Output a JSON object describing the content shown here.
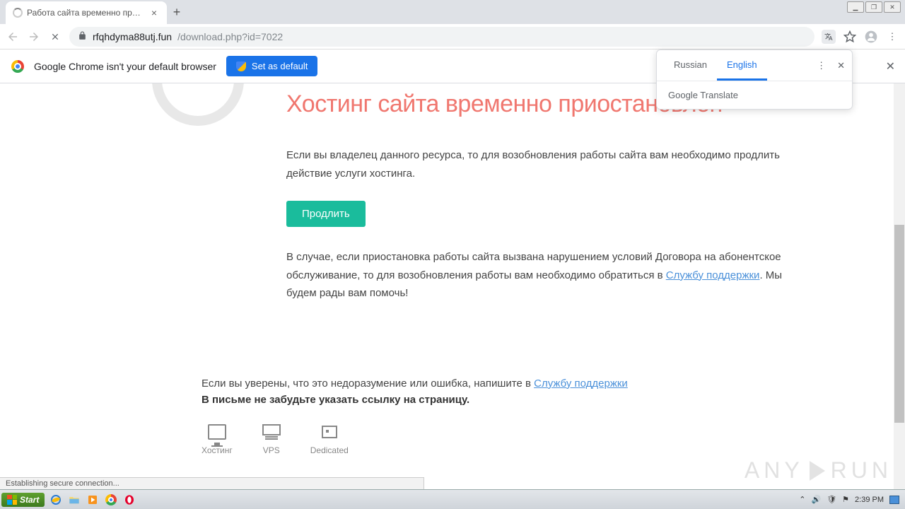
{
  "tab": {
    "title": "Работа сайта временно приостано",
    "close": "×"
  },
  "window": {
    "min": "▁",
    "max": "❐",
    "close": "✕"
  },
  "nav": {
    "back": "←",
    "fwd": "→",
    "stop": "✕",
    "newtab": "+"
  },
  "url": {
    "host": "rfqhdyma88utj.fun",
    "path": "/download.php?id=7022"
  },
  "toolbar": {
    "translate": "⠿",
    "star": "☆",
    "user": "◯",
    "menu": "⋮"
  },
  "infobar": {
    "text": "Google Chrome isn't your default browser",
    "button": "Set as default",
    "close": "✕"
  },
  "translate": {
    "tabs": {
      "russian": "Russian",
      "english": "English"
    },
    "menu": "⋮",
    "close": "✕",
    "footer_brand": "Google",
    "footer_rest": " Translate"
  },
  "page": {
    "heading": "Хостинг сайта временно приостановлен",
    "p1": "Если вы владелец данного ресурса, то для возобновления работы сайта вам необходимо продлить действие услуги хостинга.",
    "renew": "Продлить",
    "p2a": "В случае, если приостановка работы сайта вызвана нарушением условий Договора на абонентское обслуживание, то для возобновления работы вам необходимо обратиться в ",
    "p2link": "Службу поддержки",
    "p2b": ". Мы будем рады вам помочь!",
    "f1a": "Если вы уверены, что это недоразумение или ошибка, напишите в ",
    "f1link": "Службу поддержки",
    "f2": "В письме не забудьте указать ссылку на страницу.",
    "svc": {
      "hosting": "Хостинг",
      "vps": "VPS",
      "dedicated": "Dedicated"
    }
  },
  "status": "Establishing secure connection...",
  "watermark": {
    "a": "ANY",
    "b": "RUN"
  },
  "taskbar": {
    "start": "Start",
    "time": "2:39 PM"
  }
}
